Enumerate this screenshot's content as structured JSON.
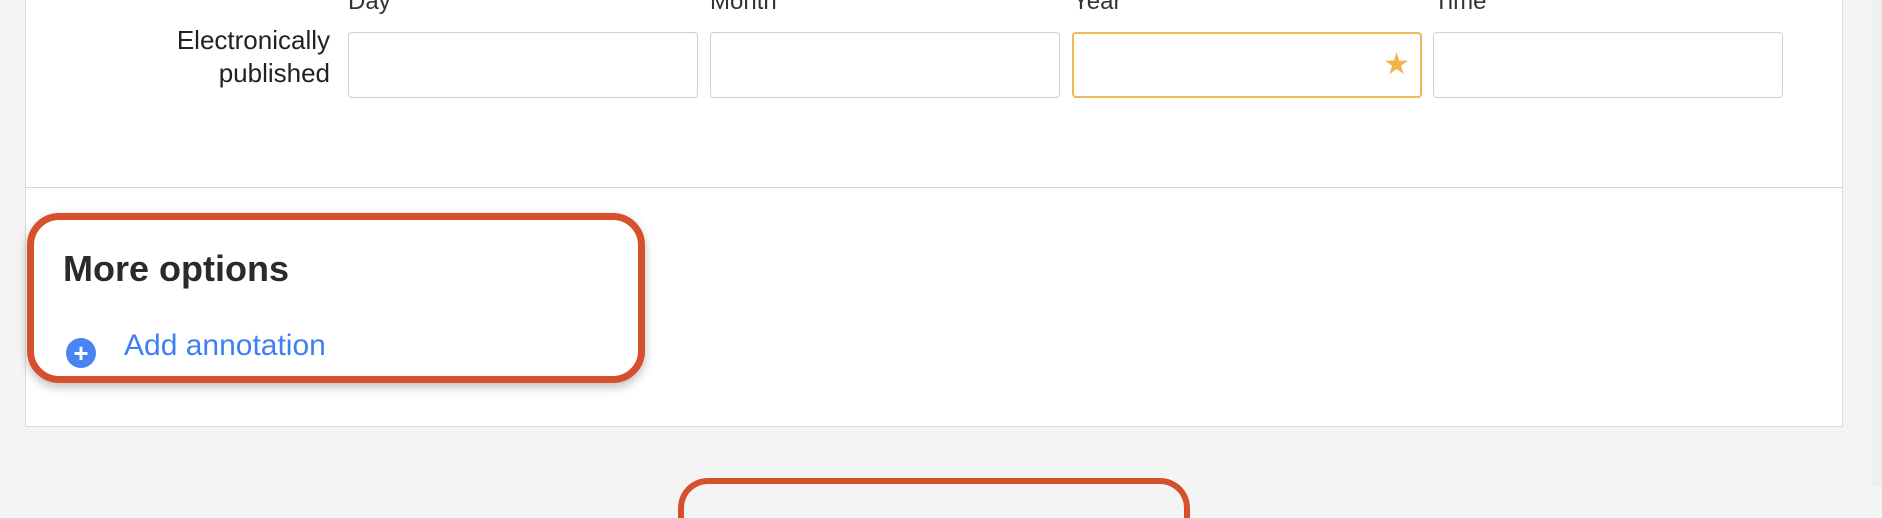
{
  "date_row": {
    "label": "Electronically published",
    "columns": [
      {
        "label": "Day",
        "value": ""
      },
      {
        "label": "Month",
        "value": ""
      },
      {
        "label": "Year",
        "value": ""
      },
      {
        "label": "Time",
        "value": ""
      }
    ]
  },
  "more_options": {
    "title": "More options",
    "add_annotation_label": "Add annotation",
    "add_icon": "plus-circle-icon"
  },
  "colors": {
    "accent_focus": "#ecb95a",
    "highlight": "#d6502e",
    "link": "#3f7ff0",
    "plus_circle": "#4a84f2",
    "required_star": "#f0b44d"
  },
  "icons": {
    "required": "star-icon"
  }
}
